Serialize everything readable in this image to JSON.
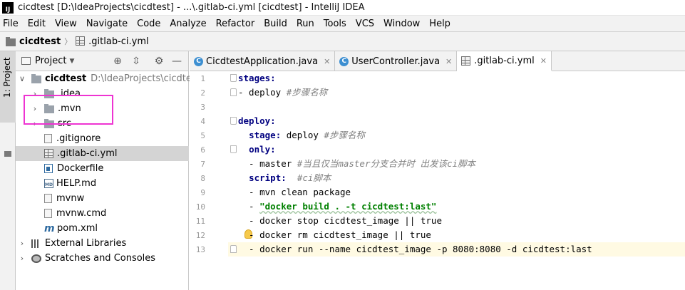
{
  "window": {
    "title": "cicdtest [D:\\IdeaProjects\\cicdtest] - ...\\.gitlab-ci.yml [cicdtest] - IntelliJ IDEA",
    "logo": "IJ"
  },
  "menu": [
    "File",
    "Edit",
    "View",
    "Navigate",
    "Code",
    "Analyze",
    "Refactor",
    "Build",
    "Run",
    "Tools",
    "VCS",
    "Window",
    "Help"
  ],
  "breadcrumb": {
    "project": "cicdtest",
    "file": ".gitlab-ci.yml"
  },
  "stripe": {
    "label": "1: Project"
  },
  "project_panel": {
    "title": "Project",
    "tree": [
      {
        "label": "cicdtest",
        "path": "D:\\IdeaProjects\\cicdtest",
        "icon": "folder",
        "expanded": true
      },
      {
        "label": ".idea",
        "icon": "folder"
      },
      {
        "label": ".mvn",
        "icon": "folder"
      },
      {
        "label": "src",
        "icon": "folder"
      },
      {
        "label": ".gitignore",
        "icon": "file"
      },
      {
        "label": ".gitlab-ci.yml",
        "icon": "yml",
        "selected": true
      },
      {
        "label": "Dockerfile",
        "icon": "docker"
      },
      {
        "label": "HELP.md",
        "icon": "md",
        "icon_text": "MD"
      },
      {
        "label": "mvnw",
        "icon": "file"
      },
      {
        "label": "mvnw.cmd",
        "icon": "file"
      },
      {
        "label": "pom.xml",
        "icon": "maven",
        "icon_text": "m"
      },
      {
        "label": "External Libraries",
        "icon": "library"
      },
      {
        "label": "Scratches and Consoles",
        "icon": "scratch"
      }
    ]
  },
  "tabs": [
    {
      "label": "CicdtestApplication.java",
      "icon": "class",
      "icon_text": "C"
    },
    {
      "label": "UserController.java",
      "icon": "class",
      "icon_text": "C"
    },
    {
      "label": ".gitlab-ci.yml",
      "icon": "yml",
      "active": true
    }
  ],
  "editor": {
    "current_line": 13,
    "lines": [
      [
        {
          "t": "stages:",
          "c": "k"
        }
      ],
      [
        {
          "t": "- deploy ",
          "c": "p"
        },
        {
          "t": "#步骤名称",
          "c": "c"
        }
      ],
      [],
      [
        {
          "t": "deploy:",
          "c": "k"
        }
      ],
      [
        {
          "t": "  ",
          "c": "p"
        },
        {
          "t": "stage:",
          "c": "k"
        },
        {
          "t": " deploy ",
          "c": "p"
        },
        {
          "t": "#步骤名称",
          "c": "c"
        }
      ],
      [
        {
          "t": "  ",
          "c": "p"
        },
        {
          "t": "only:",
          "c": "k"
        }
      ],
      [
        {
          "t": "  - master ",
          "c": "p"
        },
        {
          "t": "#当且仅当master分支合并时 出发该ci脚本",
          "c": "c"
        }
      ],
      [
        {
          "t": "  ",
          "c": "p"
        },
        {
          "t": "script:",
          "c": "k"
        },
        {
          "t": "  ",
          "c": "p"
        },
        {
          "t": "#ci脚本",
          "c": "c"
        }
      ],
      [
        {
          "t": "  - mvn clean package",
          "c": "p"
        }
      ],
      [
        {
          "t": "  - ",
          "c": "p"
        },
        {
          "t": "\"docker build . -t cicdtest:last\"",
          "c": "s"
        }
      ],
      [
        {
          "t": "  - docker stop cicdtest_image || true",
          "c": "p"
        }
      ],
      [
        {
          "t": "  - docker rm cicdtest_image || true",
          "c": "p"
        }
      ],
      [
        {
          "t": "  - docker run --name cicdtest_image -p 8080:8080 -d cicdtest:last",
          "c": "p"
        }
      ]
    ]
  },
  "colors": {
    "keyword": "#000080",
    "comment": "#808080",
    "string": "#008000",
    "highlight": "#ee34d2",
    "current_line": "#fffae3"
  }
}
